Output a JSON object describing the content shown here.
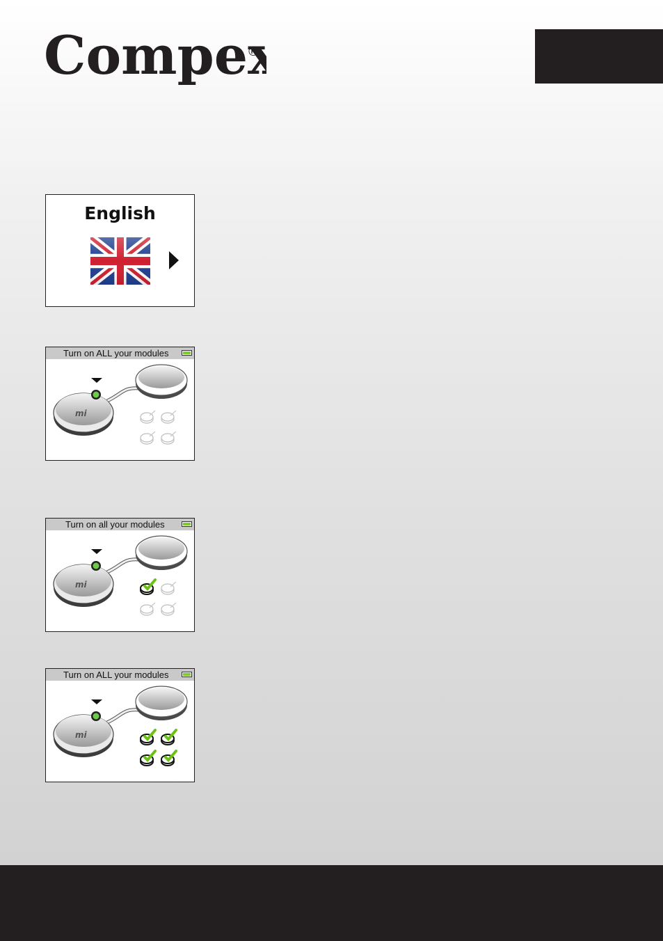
{
  "brand": {
    "name": "Compex",
    "registered_mark": "®"
  },
  "language_screen": {
    "language": "English",
    "flag": "uk-flag-icon",
    "next": "arrow-right-icon"
  },
  "module_screens": [
    {
      "title": "Turn on ALL your modules",
      "modules_ok": 0,
      "modules_total": 4
    },
    {
      "title": "Turn on all your modules",
      "modules_ok": 1,
      "modules_total": 4
    },
    {
      "title": "Turn on ALL your modules",
      "modules_ok": 4,
      "modules_total": 4
    }
  ],
  "colors": {
    "dark": "#231f20",
    "battery": "#7ccc2a",
    "check": "#6cc117",
    "header": "#c9c9c9"
  }
}
